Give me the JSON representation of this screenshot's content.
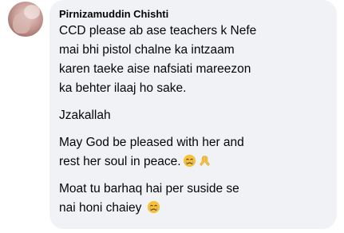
{
  "comment": {
    "author": "Pirnizamuddin Chishti",
    "paragraphs": [
      "CCD please ab ase teachers k Nefe\nmai bhi pistol chalne ka intzaam\nkaren taeke aise nafsiati mareezon\nka behter ilaaj ho sake.",
      "Jzakallah",
      "May God be pleased with her and\nrest her soul in peace.",
      "Moat tu barhaq hai per suside se\nnai honi chaiey"
    ],
    "emojis": {
      "paragraph_3": [
        "crying-face",
        "folded-hands"
      ],
      "paragraph_4": [
        "crying-face"
      ]
    }
  }
}
